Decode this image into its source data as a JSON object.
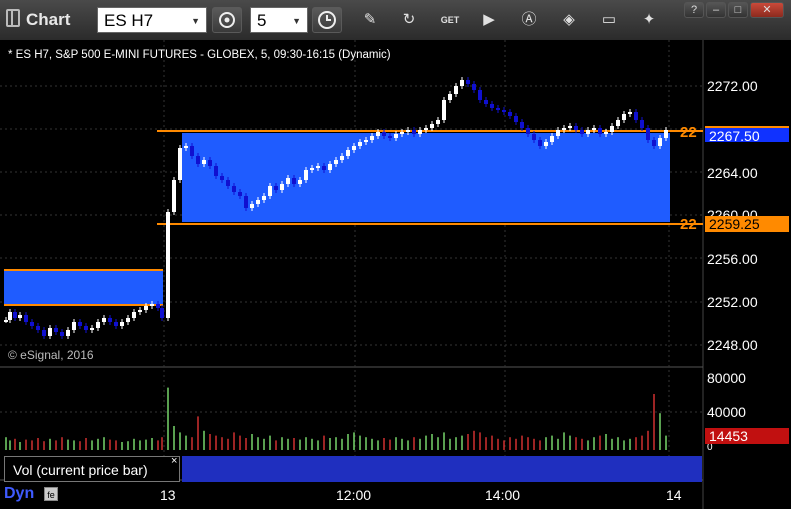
{
  "window": {
    "title": "Chart",
    "symbol": "ES H7",
    "interval": "5"
  },
  "chart": {
    "subtitle": "* ES H7, S&P 500 E-MINI FUTURES - GLOBEX, 5, 09:30-16:15 (Dynamic)",
    "copyright": "© eSignal, 2016",
    "price_axis": [
      "2272.00",
      "2264.00",
      "2260.00",
      "2256.00",
      "2252.00",
      "2248.00"
    ],
    "current_price_tag": "2267.50",
    "lower_level_tag": "2259.25",
    "level_prefix_upper": "22",
    "level_prefix_lower": "22",
    "colors": {
      "zone": "#1f5cff",
      "level_line": "#ff8a00",
      "up_candle": "#ffffff",
      "down_candle": "#1010d0",
      "vol_up": "#77d66b",
      "vol_down": "#d13131",
      "current_tag_bg": "#1032ff",
      "level_tag_bg": "#ff8a00",
      "vol_tag_bg": "#c11010"
    }
  },
  "volume": {
    "axis": [
      "80000",
      "40000",
      "0"
    ],
    "current_volume": "14453",
    "label": "Vol (current price bar)",
    "close_symbol": "×"
  },
  "time_axis": {
    "mode": "Dyn",
    "labels": [
      "13",
      "12:00",
      "14:00",
      "14"
    ]
  },
  "toolbar": {
    "icons": [
      "pencil-icon",
      "refresh-icon",
      "get-icon",
      "play-icon",
      "alert-icon",
      "tag-icon",
      "comment-icon",
      "twitter-icon"
    ]
  }
}
